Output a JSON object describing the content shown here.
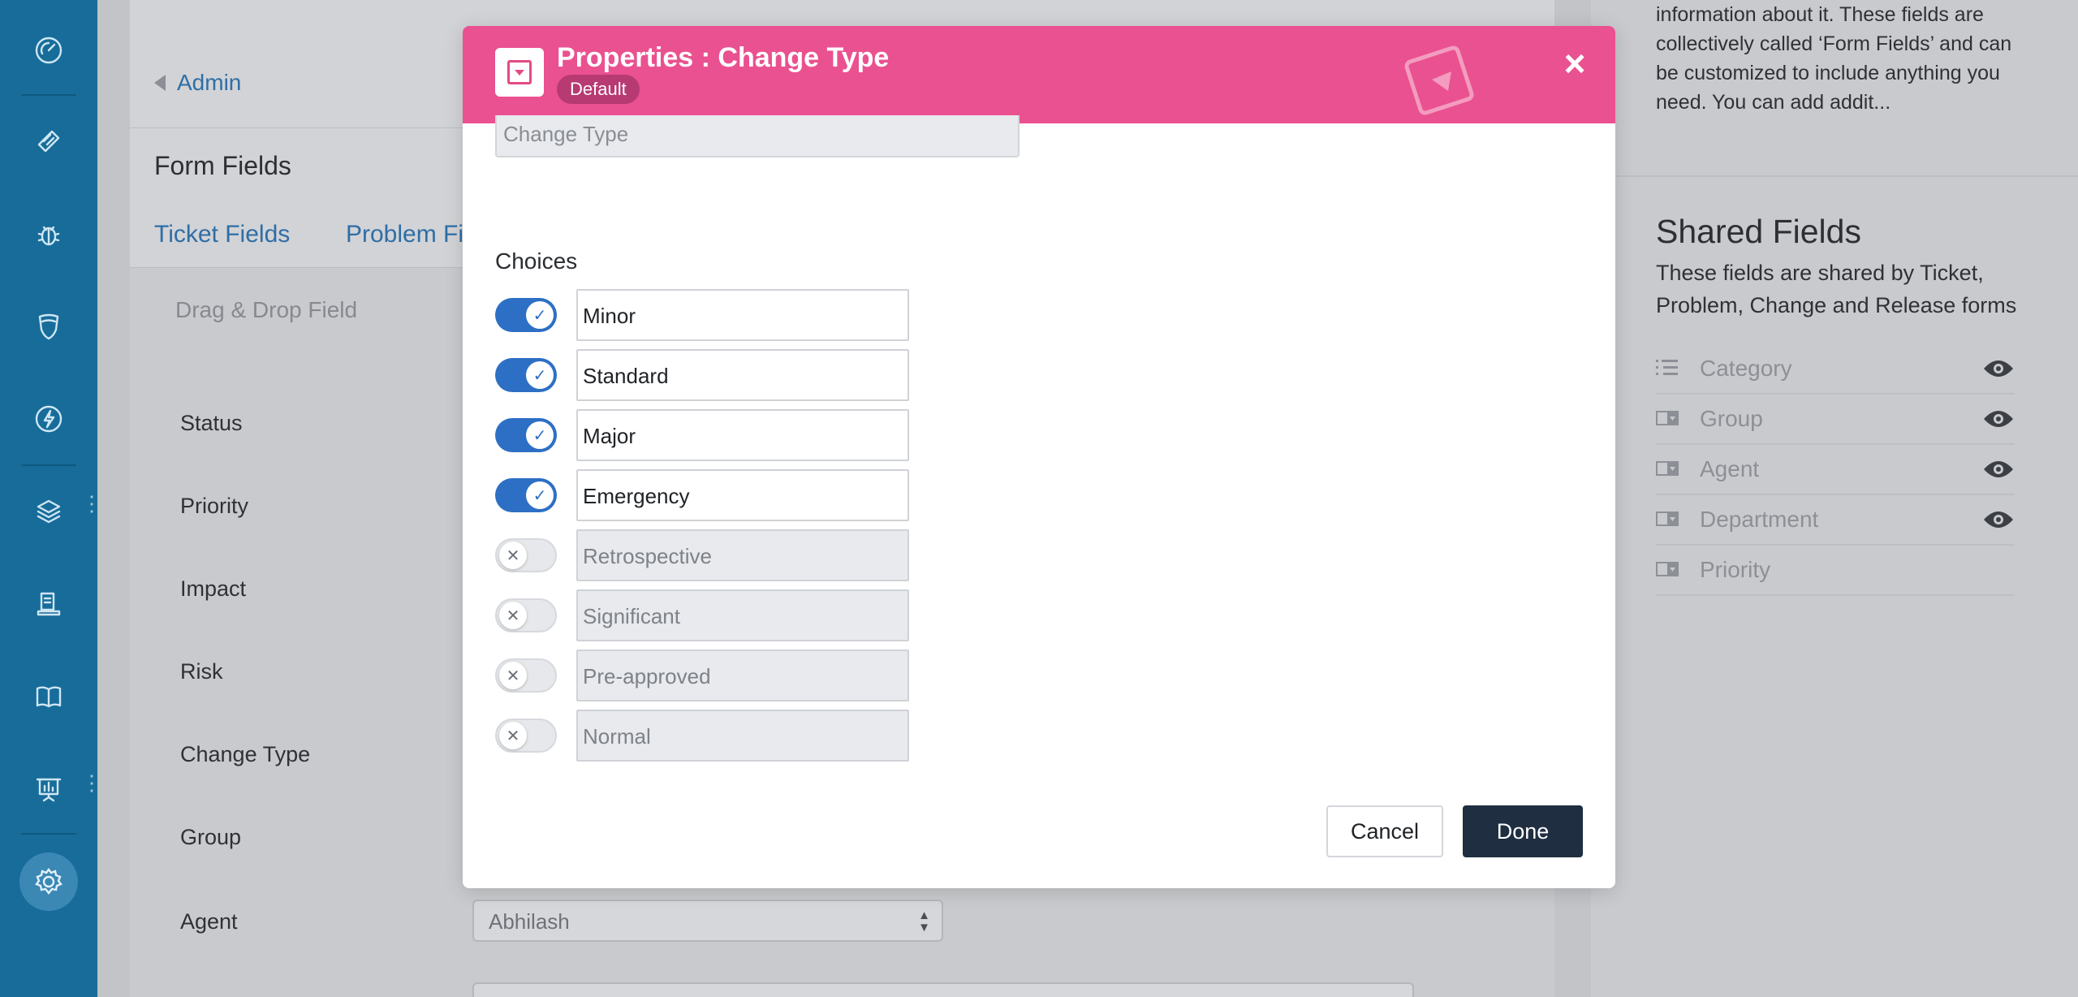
{
  "sidebar": {
    "icons": [
      {
        "name": "dashboard-icon"
      },
      {
        "name": "ticket-icon"
      },
      {
        "name": "bug-icon"
      },
      {
        "name": "shield-icon"
      },
      {
        "name": "lightning-icon"
      },
      {
        "name": "layers-icon"
      },
      {
        "name": "release-icon"
      },
      {
        "name": "book-icon"
      },
      {
        "name": "reports-icon"
      },
      {
        "name": "settings-icon"
      }
    ],
    "accent": "#176c9a"
  },
  "background": {
    "back_link": "Admin",
    "page_title": "Form Fields",
    "tabs": [
      "Ticket Fields",
      "Problem Fi"
    ],
    "drag_hint": "Drag & Drop Field",
    "fields": [
      "Status",
      "Priority",
      "Impact",
      "Risk",
      "Change Type",
      "Group",
      "Agent"
    ],
    "agent_value": "Abhilash"
  },
  "help": {
    "text": "information about it. These fields are collectively called ‘Form Fields’ and can be customized to include anything you need. You can add addit...",
    "shared_title": "Shared Fields",
    "shared_desc": "These fields are shared by Ticket, Problem, Change and Release forms",
    "shared_fields": [
      {
        "label": "Category",
        "icon": "list-icon",
        "visible": true
      },
      {
        "label": "Group",
        "icon": "dropdown-icon",
        "visible": true
      },
      {
        "label": "Agent",
        "icon": "dropdown-icon",
        "visible": true
      },
      {
        "label": "Department",
        "icon": "dropdown-icon",
        "visible": true
      },
      {
        "label": "Priority",
        "icon": "dropdown-icon",
        "visible": false
      }
    ]
  },
  "modal": {
    "title": "Properties : Change Type",
    "badge": "Default",
    "close_label": "×",
    "field_name_value": "Change Type",
    "choices_label": "Choices",
    "choices": [
      {
        "label": "Minor",
        "enabled": true
      },
      {
        "label": "Standard",
        "enabled": true
      },
      {
        "label": "Major",
        "enabled": true
      },
      {
        "label": "Emergency",
        "enabled": true
      },
      {
        "label": "Retrospective",
        "enabled": false
      },
      {
        "label": "Significant",
        "enabled": false
      },
      {
        "label": "Pre-approved",
        "enabled": false
      },
      {
        "label": "Normal",
        "enabled": false
      }
    ],
    "cancel_label": "Cancel",
    "done_label": "Done",
    "header_color": "#ea5190",
    "done_color": "#1f2e40",
    "toggle_on_color": "#2d6fc4"
  }
}
